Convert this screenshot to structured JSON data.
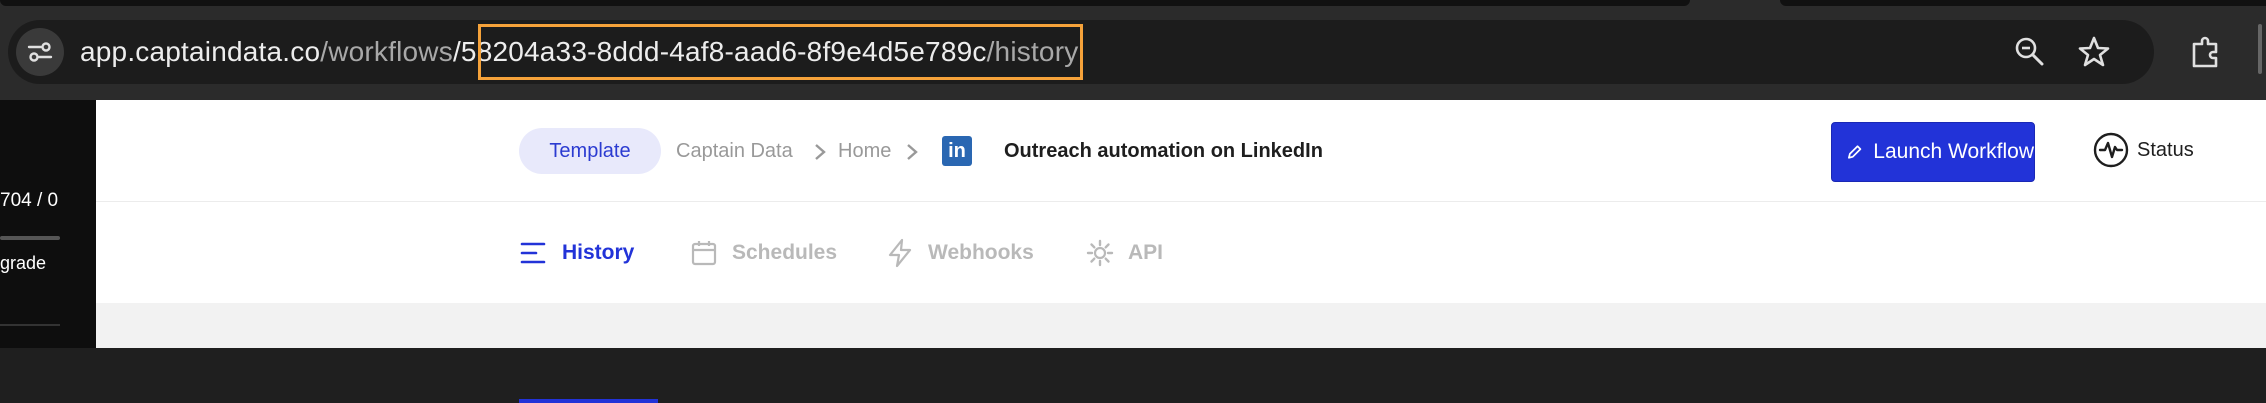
{
  "browser": {
    "url_host": "app.captaindata.co",
    "url_path_1": "/workflows",
    "url_highlighted": "/58204a33-8ddd-4af8-aad6-8f9e4d5e789c",
    "url_path_2": "/history",
    "icons": [
      "site-info-icon",
      "zoom-icon",
      "bookmark-star-icon",
      "extensions-icon"
    ],
    "highlight_color": "#f5a23a"
  },
  "sidebar": {
    "usage_text": "704 / 0",
    "upgrade_label": "grade"
  },
  "header": {
    "template_label": "Template",
    "breadcrumb": [
      "Captain Data",
      "Home"
    ],
    "platform_icon": "linkedin-icon",
    "workflow_title": "Outreach automation on LinkedIn",
    "launch_label": "Launch Workflow",
    "status_label": "Status"
  },
  "tabs": [
    {
      "label": "History",
      "icon": "list-icon",
      "active": true
    },
    {
      "label": "Schedules",
      "icon": "calendar-icon",
      "active": false
    },
    {
      "label": "Webhooks",
      "icon": "lightning-icon",
      "active": false
    },
    {
      "label": "API",
      "icon": "gear-icon",
      "active": false
    }
  ],
  "colors": {
    "accent": "#2233d8",
    "pill_bg": "#e8e9fb",
    "linkedin": "#2a67b2"
  }
}
